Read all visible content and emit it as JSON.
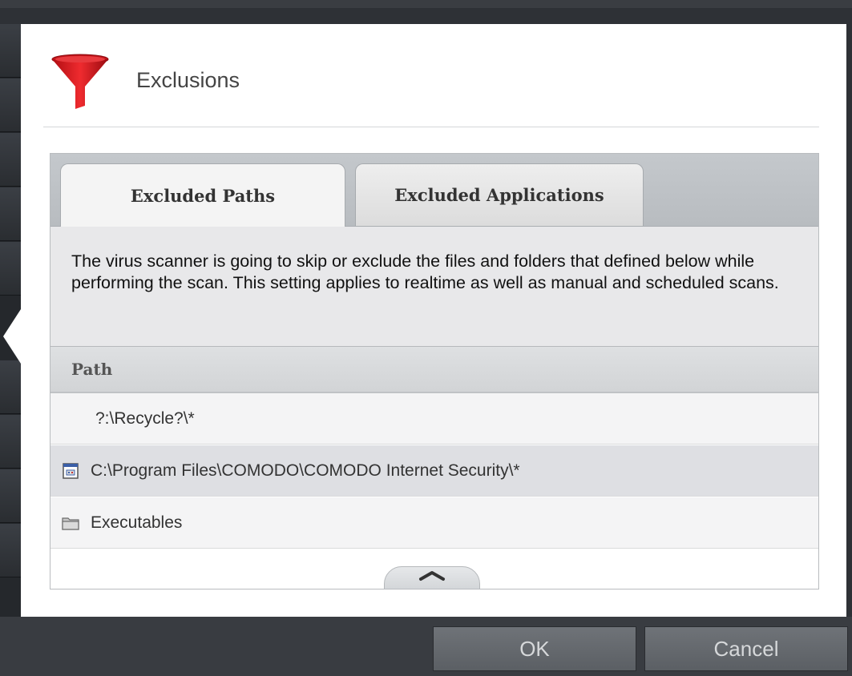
{
  "dialog": {
    "title": "Exclusions",
    "icon": "funnel-filter-icon"
  },
  "tabs": [
    {
      "label": "Excluded Paths",
      "active": true
    },
    {
      "label": "Excluded Applications",
      "active": false
    }
  ],
  "description": "The virus scanner is going to skip or exclude the files and folders that defined below while performing the scan. This setting applies to realtime as well as manual and scheduled scans.",
  "table": {
    "column_header": "Path",
    "rows": [
      {
        "label": "?:\\Recycle?\\*",
        "icon": "none"
      },
      {
        "label": "C:\\Program Files\\COMODO\\COMODO Internet Security\\*",
        "icon": "program-file-icon"
      },
      {
        "label": "Executables",
        "icon": "folder-icon"
      }
    ]
  },
  "footer": {
    "ok_label": "OK",
    "cancel_label": "Cancel"
  },
  "colors": {
    "accent_red": "#d4141b",
    "footer_bg": "#393c41",
    "selected_row": "#dedfe3"
  }
}
